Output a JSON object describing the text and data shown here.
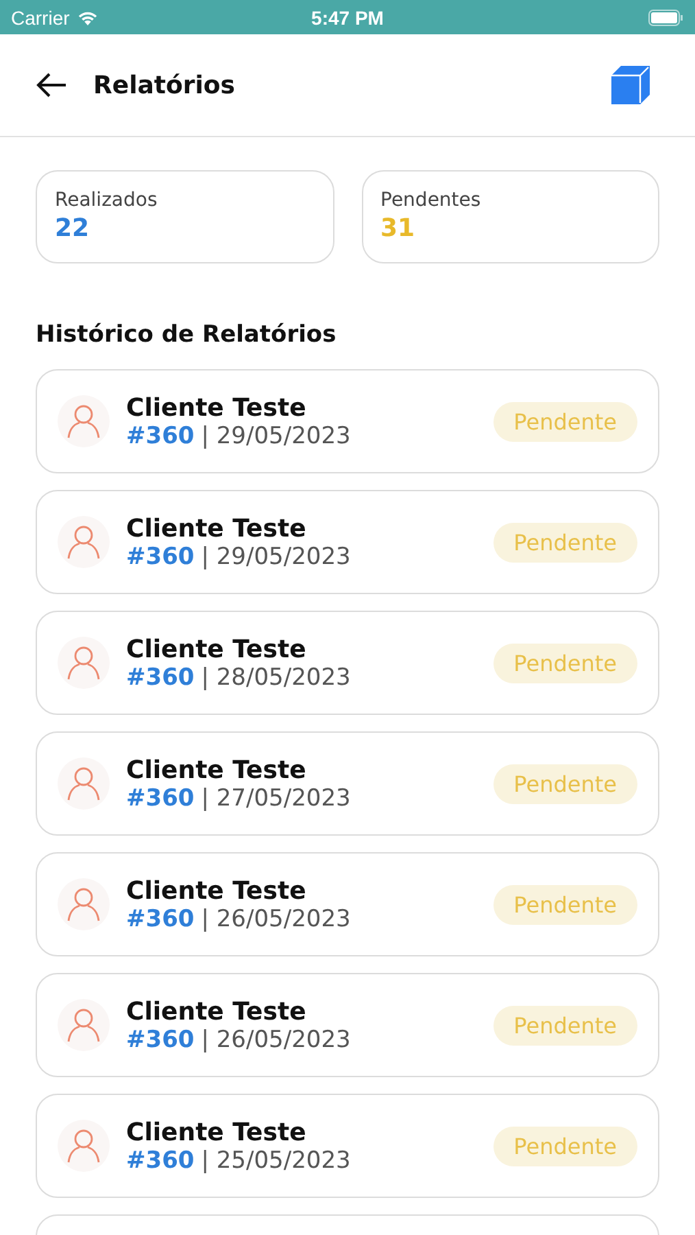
{
  "status_bar": {
    "carrier": "Carrier",
    "time": "5:47 PM"
  },
  "header": {
    "title": "Relatórios"
  },
  "stats": [
    {
      "label": "Realizados",
      "value": "22",
      "kind": "done"
    },
    {
      "label": "Pendentes",
      "value": "31",
      "kind": "pending"
    }
  ],
  "section_title": "Histórico de Relatórios",
  "reports": [
    {
      "client": "Cliente Teste",
      "number": "#360",
      "date": "| 29/05/2023",
      "status": "Pendente",
      "kind": "pending"
    },
    {
      "client": "Cliente Teste",
      "number": "#360",
      "date": "| 29/05/2023",
      "status": "Pendente",
      "kind": "pending"
    },
    {
      "client": "Cliente Teste",
      "number": "#360",
      "date": "| 28/05/2023",
      "status": "Pendente",
      "kind": "pending"
    },
    {
      "client": "Cliente Teste",
      "number": "#360",
      "date": "| 27/05/2023",
      "status": "Pendente",
      "kind": "pending"
    },
    {
      "client": "Cliente Teste",
      "number": "#360",
      "date": "| 26/05/2023",
      "status": "Pendente",
      "kind": "pending"
    },
    {
      "client": "Cliente Teste",
      "number": "#360",
      "date": "| 26/05/2023",
      "status": "Pendente",
      "kind": "pending"
    },
    {
      "client": "Cliente Teste",
      "number": "#360",
      "date": "| 25/05/2023",
      "status": "Pendente",
      "kind": "pending"
    }
  ]
}
